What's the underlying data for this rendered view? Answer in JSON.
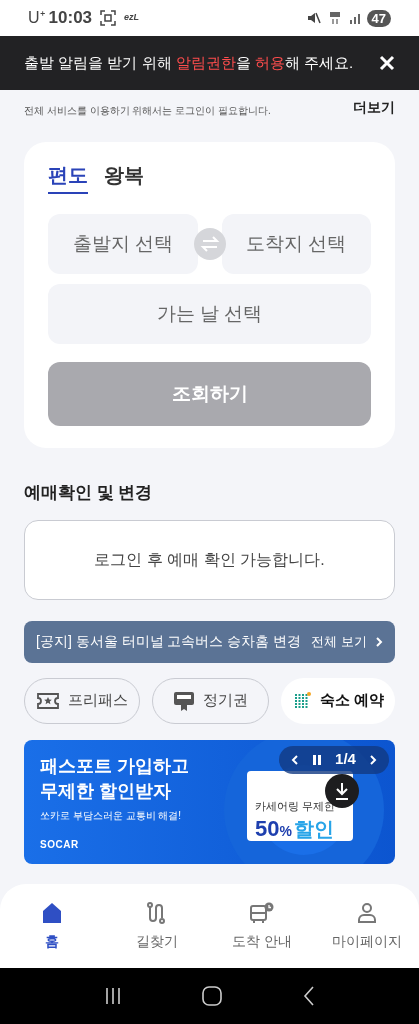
{
  "status_bar": {
    "carrier": "U⁺",
    "time": "10:03",
    "app_label": "ezL",
    "battery": "47"
  },
  "permission_banner": {
    "message": "출발 알림을 받기 위해 **알림권한**을 **허용**해 주세요."
  },
  "login_hint": {
    "text": "전체 서비스를 이용하기 위해서는 로그인이 필요합니다.",
    "more": "더보기"
  },
  "booking": {
    "tabs": [
      {
        "label": "편도",
        "selected": true
      },
      {
        "label": "왕복",
        "selected": false
      }
    ],
    "departure": {
      "placeholder": "출발지 선택"
    },
    "arrival": {
      "placeholder": "도착지 선택"
    },
    "date": {
      "placeholder": "가는 날 선택"
    },
    "search_button": {
      "label": "조회하기",
      "disabled": true
    }
  },
  "reservation": {
    "title": "예매확인 및 변경",
    "message": "로그인 후 예매 확인 가능합니다."
  },
  "notice": {
    "text": "[공지] 동서울 터미널 고속버스 승차홈 변경",
    "link": "전체 보기"
  },
  "chips": [
    {
      "kind": "freepass",
      "label": "프리패스"
    },
    {
      "kind": "commuter",
      "label": "정기권"
    },
    {
      "kind": "lodging",
      "label": "숙소 예약"
    }
  ],
  "ad_banner": {
    "title": "패스포트 가입하고\n무제한 할인받자",
    "subtitle": "쏘카로 부담스러운 교통비 해결!",
    "brand": "SOCAR",
    "card_caption": "카세어링 무제한",
    "card_amount": "50",
    "card_unit": "%",
    "card_word": "할인",
    "pager": "1/4"
  },
  "bottom_nav": [
    {
      "kind": "home",
      "label": "홈",
      "selected": true
    },
    {
      "kind": "route",
      "label": "길찾기",
      "selected": false
    },
    {
      "kind": "arrival",
      "label": "도착 안내",
      "selected": false
    },
    {
      "kind": "mypage",
      "label": "마이페이지",
      "selected": false
    }
  ]
}
